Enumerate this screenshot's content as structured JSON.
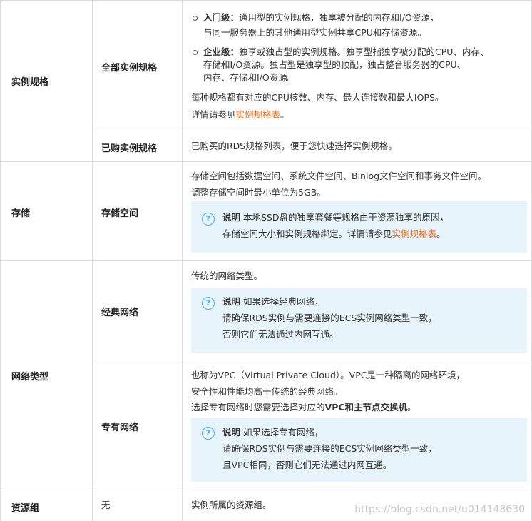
{
  "rows": {
    "spec": {
      "category": "实例规格",
      "all": {
        "label": "全部实例规格",
        "entry": {
          "bold": "入门级：",
          "line1": "通用型的实例规格，独享被分配的内存和I/O资源，",
          "line2": "与同一服务器上的其他通用型实例共享CPU和存储资源。"
        },
        "enterprise": {
          "bold": "企业级：",
          "line1": "独享或独占型的实例规格。独享型指独享被分配的CPU、内存、",
          "line2": "存储和I/O资源。独占型是独享型的顶配，独占整台服务器的CPU、",
          "line3": "内存、存储和I/O资源。"
        },
        "para1": "每种规格都有对应的CPU核数、内存、最大连接数和最大IOPS。",
        "para2_prefix": "详情请参见",
        "para2_link": "实例规格表",
        "para2_suffix": "。"
      },
      "purchased": {
        "label": "已购实例规格",
        "text": "已购买的RDS规格列表，便于您快速选择实例规格。"
      }
    },
    "storage": {
      "category": "存储",
      "label": "存储空间",
      "line1": "存储空间包括数据空间、系统文件空间、Binlog文件空间和事务文件空间。",
      "line2": "调整存储空间时最小单位为5GB。",
      "note": {
        "title": "说明",
        "line1": "本地SSD盘的独享套餐等规格由于资源独享的原因，",
        "line2_prefix": "存储空间大小和实例规格绑定。详情请参见",
        "line2_link": "实例规格表",
        "line2_suffix": "。"
      }
    },
    "network": {
      "category": "网络类型",
      "classic": {
        "label": "经典网络",
        "text": "传统的网络类型。",
        "note": {
          "title": "说明",
          "line1": "如果选择经典网络，",
          "line2": "请确保RDS实例与需要连接的ECS实例网络类型一致，",
          "line3": "否则它们无法通过内网互通。"
        }
      },
      "vpc": {
        "label": "专有网络",
        "line1": "也称为VPC（Virtual Private Cloud）。VPC是一种隔离的网络环境，",
        "line2": "安全性和性能均高于传统的经典网络。",
        "line3_prefix": "选择专有网络时您需要选择对应的",
        "line3_bold": "VPC和主节点交换机",
        "line3_suffix": "。",
        "note": {
          "title": "说明",
          "line1": "如果选择专有网络，",
          "line2": "请确保RDS实例与需要连接的ECS实例网络类型一致，",
          "line3": "且VPC相同，否则它们无法通过内网互通。"
        }
      }
    },
    "rg": {
      "category": "资源组",
      "value": "无",
      "text": "实例所属的资源组。"
    }
  },
  "icons": {
    "note": "question-circle-icon"
  },
  "colors": {
    "link": "#e96a17",
    "note_bg": "#e8f4fb",
    "note_icon": "#48a9e6"
  },
  "watermark": "https://blog.csdn.net/u014148630"
}
